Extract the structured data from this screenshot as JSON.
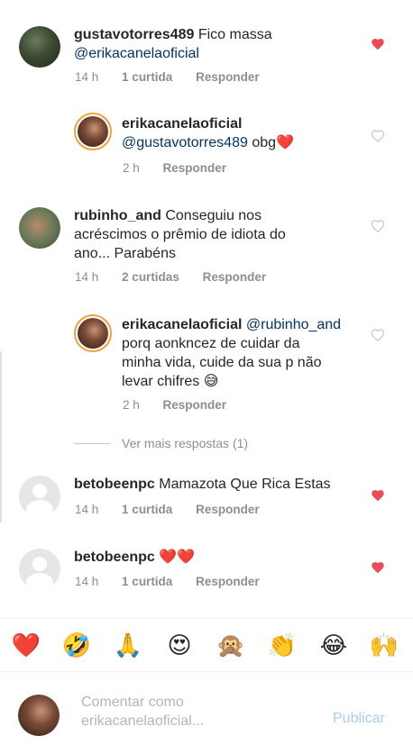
{
  "comments": [
    {
      "username": "gustavotorres489",
      "text": " Fico massa",
      "mention": "@erikacanelaoficial",
      "time": "14 h",
      "likes": "1 curtida",
      "reply": "Responder",
      "liked": true
    },
    {
      "username": "erikacanelaoficial",
      "mention": "@gustavotorres489",
      "text": " obg❤️",
      "time": "2 h",
      "reply": "Responder",
      "liked": false
    },
    {
      "username": "rubinho_and",
      "text_line1": " Conseguiu nos",
      "text_line2": "acréscimos o prêmio de idiota do",
      "text_line3": "ano... Parabéns",
      "time": "14 h",
      "likes": "2 curtidas",
      "reply": "Responder",
      "liked": false
    },
    {
      "username": "erikacanelaoficial",
      "mention": " @rubinho_and",
      "text_line2": "porq aonkncez de cuidar da",
      "text_line3": "minha vida, cuide da sua p não",
      "text_line4": "levar chifres 😅",
      "time": "2 h",
      "reply": "Responder",
      "liked": false
    },
    {
      "username": "betobeenpc",
      "text": " Mamazota Que Rica Estas",
      "time": "14 h",
      "likes": "1 curtida",
      "reply": "Responder",
      "liked": true
    },
    {
      "username": "betobeenpc",
      "text": " ❤️❤️",
      "time": "14 h",
      "likes": "1 curtida",
      "reply": "Responder",
      "liked": true
    }
  ],
  "more_replies": "Ver mais respostas (1)",
  "emoji_bar": [
    "❤️",
    "🤣",
    "🙏",
    "😍",
    "🙊",
    "👏",
    "😂",
    "🙌"
  ],
  "composer": {
    "placeholder_line1": "Comentar como",
    "placeholder_line2": "erikacanelaoficial...",
    "publish_label": "Publicar"
  },
  "colors": {
    "heart_liked": "#ed4956",
    "heart_unliked": "#c7c7c7",
    "mention": "#003569",
    "meta": "#8e8e8e",
    "publish": "#a9cdf4"
  },
  "icons": {
    "like_icon": "heart-outline",
    "liked_icon": "heart-filled",
    "default_avatar": "person-silhouette"
  }
}
